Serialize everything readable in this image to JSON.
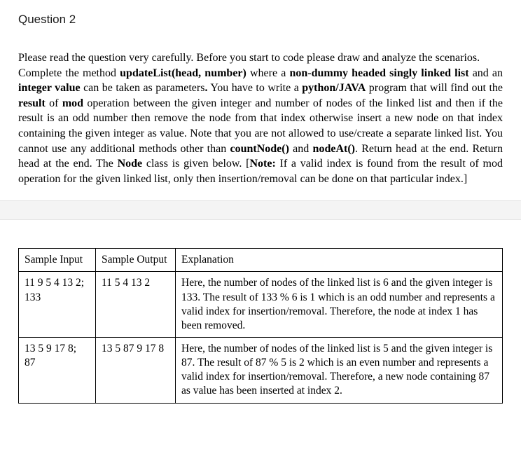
{
  "title": "Question 2",
  "intro": "Please read the question very carefully. Before you start to code please draw and analyze the scenarios.",
  "body_html": "Complete the method <b>updateList(head, number)</b> where a <b>non-dummy headed singly linked list</b> and an <b>integer value</b> can be taken as parameters<b>.</b> You have to write a <b>python/JAVA</b> program that will find out the <b>result</b> of <b>mod</b> operation between the given integer and number of nodes of the linked list and then if the result is an odd number then remove the node from that index otherwise insert a new node on that index containing the given integer as value. Note that you are not allowed to use/create a separate linked list. You cannot use any additional methods other than <b>countNode()</b> and <b>nodeAt()</b>. Return head at the end. Return head at the end. The <b>Node</b> class is given below. [<b>Note:</b> If a valid index is found from the result of mod operation for the given linked list, only then insertion/removal can be done on that particular index.]",
  "table": {
    "headers": {
      "input": "Sample Input",
      "output": "Sample Output",
      "explanation": "Explanation"
    },
    "rows": [
      {
        "input": "11 9 5 4 13 2; 133",
        "output": "11 5 4 13 2",
        "explanation": "Here, the number of nodes of the linked list is 6 and the given integer is 133. The result of 133 % 6 is 1 which is an odd number and represents a valid index for insertion/removal. Therefore, the node at index 1 has been removed."
      },
      {
        "input": "13 5 9 17 8; 87",
        "output": "13 5 87 9 17 8",
        "explanation": "Here, the number of nodes of the linked list is 5 and the given integer is 87. The result of 87 % 5 is 2 which is an even number and represents a valid index for insertion/removal. Therefore, a new node containing 87 as value has been inserted at index 2."
      }
    ]
  }
}
